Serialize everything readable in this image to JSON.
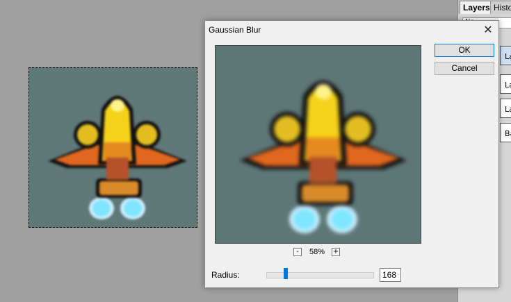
{
  "panel": {
    "tabs": [
      {
        "label": "Layers"
      },
      {
        "label": "Histo"
      }
    ],
    "blend_mode": "No",
    "layers": [
      {
        "label": "La",
        "selected": true
      },
      {
        "label": "La",
        "selected": false
      },
      {
        "label": "La",
        "selected": false
      },
      {
        "label": "Ba",
        "selected": false
      }
    ]
  },
  "dialog": {
    "title": "Gaussian Blur",
    "close_icon": "✕",
    "ok_label": "OK",
    "cancel_label": "Cancel",
    "zoom_out_label": "-",
    "zoom_in_label": "+",
    "zoom_level": "58%",
    "radius_label": "Radius:",
    "radius_value": "168",
    "radius_slider_fraction": 0.17
  },
  "colors": {
    "background_teal": "#5f7878",
    "accent_blue": "#0078d7",
    "ship_yellow": "#f5d21a",
    "ship_orange": "#e0671e",
    "flame_cyan": "#7fe6ff"
  },
  "icons": {
    "ship": "spaceship-sprite-icon",
    "eye": "eye-icon"
  }
}
